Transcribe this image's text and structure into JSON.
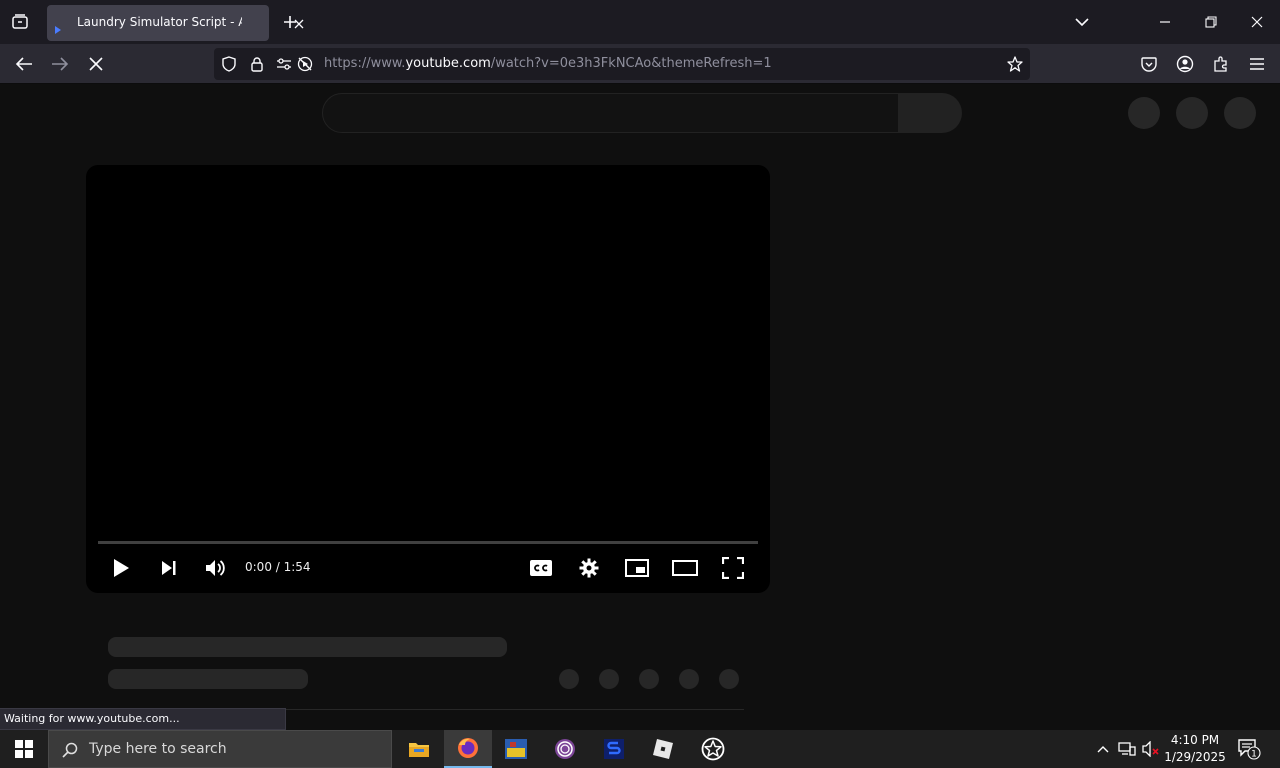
{
  "browser": {
    "tab": {
      "title": "Laundry Simulator Script - Auto"
    },
    "url": {
      "prefix": "https://www.",
      "host": "youtube.com",
      "path": "/watch?v=0e3h3FkNCAo&themeRefresh=1"
    },
    "status": "Waiting for www.youtube.com..."
  },
  "player": {
    "time": "0:00 / 1:54",
    "progress_fraction": 0
  },
  "taskbar": {
    "search_placeholder": "Type here to search",
    "apps": [
      "file-explorer-icon",
      "firefox-icon",
      "game-app-icon",
      "tor-browser-icon",
      "script-app-icon",
      "roblox-icon",
      "roblox-studio-icon"
    ],
    "clock_time": "4:10 PM",
    "clock_date": "1/29/2025",
    "notification_count": "1"
  },
  "colors": {
    "page_bg": "#0f0f0f",
    "skeleton": "#272727",
    "tab_active": "#42414d",
    "accent": "#76b9ed"
  }
}
